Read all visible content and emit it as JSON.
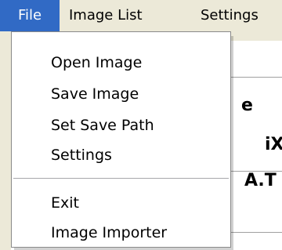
{
  "menubar": {
    "items": [
      {
        "label": "File",
        "active": true
      },
      {
        "label": "Image List",
        "active": false
      },
      {
        "label": "Settings",
        "active": false
      }
    ]
  },
  "background": {
    "fragments": [
      "e",
      "iX",
      "A.T"
    ]
  },
  "file_menu": {
    "group1": [
      "Open Image",
      "Save Image",
      "Set Save Path",
      "Settings"
    ],
    "group2": [
      "Exit",
      "Image Importer"
    ]
  },
  "colors": {
    "highlight": "#316ac5",
    "menu_bg": "#ffffff",
    "chrome": "#ece9d8"
  }
}
